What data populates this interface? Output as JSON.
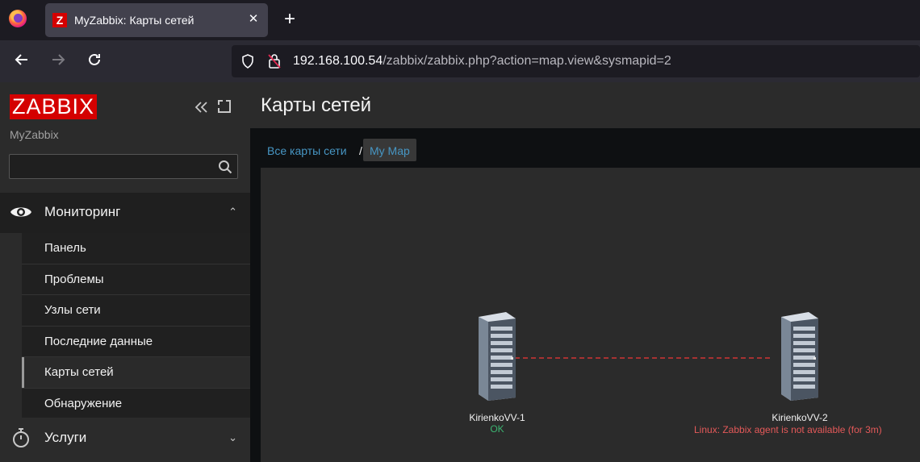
{
  "browser": {
    "tab_title": "MyZabbix: Карты сетей",
    "tab_favicon": "Z",
    "new_tab_icon": "+",
    "url_host": "192.168.100.54",
    "url_path": "/zabbix/zabbix.php?action=map.view&sysmapid=2"
  },
  "sidebar": {
    "logo": "ZABBIX",
    "server_name": "MyZabbix",
    "search_value": "",
    "sections": [
      {
        "label": "Мониторинг",
        "icon": "eye-icon",
        "expanded": true,
        "items": [
          {
            "label": "Панель"
          },
          {
            "label": "Проблемы"
          },
          {
            "label": "Узлы сети"
          },
          {
            "label": "Последние данные"
          },
          {
            "label": "Карты сетей",
            "active": true
          },
          {
            "label": "Обнаружение"
          }
        ]
      },
      {
        "label": "Услуги",
        "icon": "stopwatch-icon",
        "expanded": false
      }
    ]
  },
  "main": {
    "title": "Карты сетей",
    "breadcrumbs": {
      "parent": "Все карты сети",
      "separator": "/",
      "current": "My Map"
    },
    "map": {
      "hosts": [
        {
          "name": "KirienkoVV-1",
          "status": "OK",
          "status_color": "#3cb371"
        },
        {
          "name": "KirienkoVV-2",
          "status": "Linux: Zabbix agent is not available (for 3m)",
          "status_color": "#e45959"
        }
      ],
      "link_color": "#d03434",
      "link_style": "dashed"
    }
  },
  "colors": {
    "accent": "#d40000",
    "link": "#4796c4",
    "sidebar_bg": "#2b2b2b"
  }
}
